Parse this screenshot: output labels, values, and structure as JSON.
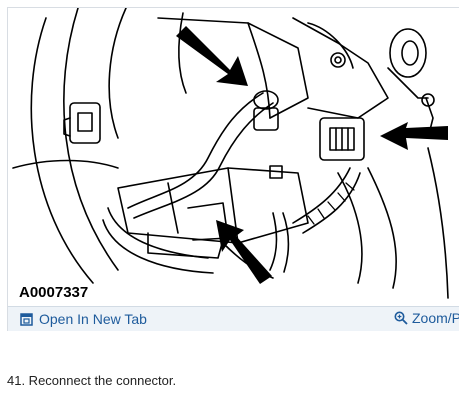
{
  "figure": {
    "id_label": "A0007337"
  },
  "links": {
    "open_tab_label": "Open In New Tab",
    "open_tab_icon": "open-in-new-tab-icon",
    "zoom_label": "Zoom/P",
    "zoom_icon": "zoom-icon"
  },
  "step": {
    "text": "41. Reconnect the connector."
  },
  "colors": {
    "link": "#1e5b9c",
    "link_bar_bg": "#eef3f8"
  }
}
